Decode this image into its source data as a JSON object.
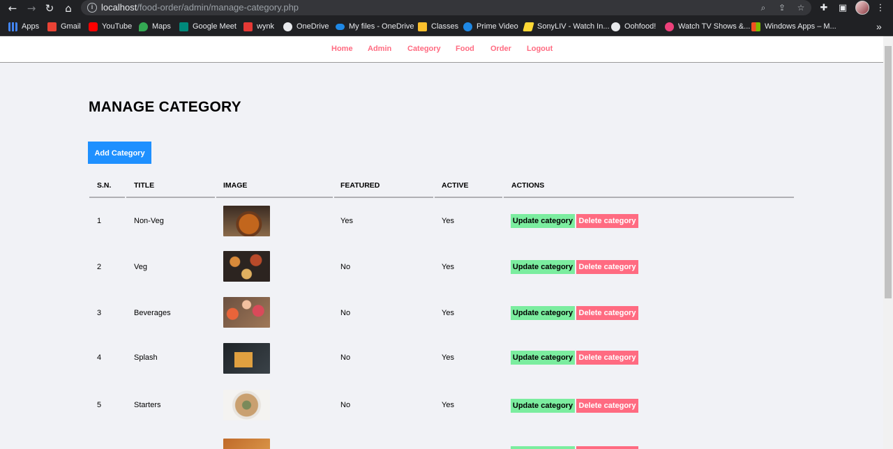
{
  "browser": {
    "url_host": "localhost",
    "url_path": "/food-order/admin/manage-category.php",
    "bookmarks": [
      {
        "label": "Apps",
        "color": "#4285f4"
      },
      {
        "label": "Gmail",
        "color": "#ea4335"
      },
      {
        "label": "YouTube",
        "color": "#ff0000"
      },
      {
        "label": "Maps",
        "color": "#34a853"
      },
      {
        "label": "Google Meet",
        "color": "#00897b"
      },
      {
        "label": "wynk",
        "color": "#e53935"
      },
      {
        "label": "OneDrive",
        "color": "#e8eaed"
      },
      {
        "label": "My files - OneDrive",
        "color": "#1e88e5"
      },
      {
        "label": "Classes",
        "color": "#fbc02d"
      },
      {
        "label": "Prime Video",
        "color": "#1e88e5"
      },
      {
        "label": "SonyLIV - Watch In...",
        "color": "#fdd835"
      },
      {
        "label": "Oohfood!",
        "color": "#e8eaed"
      },
      {
        "label": "Watch TV Shows &...",
        "color": "#ec407a"
      },
      {
        "label": "Windows Apps – M...",
        "color": "#f25022"
      }
    ]
  },
  "menu": {
    "home": "Home",
    "admin": "Admin",
    "category": "Category",
    "food": "Food",
    "order": "Order",
    "logout": "Logout"
  },
  "page": {
    "title": "MANAGE CATEGORY",
    "add_button": "Add Category"
  },
  "table": {
    "headers": [
      "S.N.",
      "TITLE",
      "IMAGE",
      "FEATURED",
      "ACTIVE",
      "ACTIONS"
    ],
    "update_label": "Update category",
    "delete_label": "Delete category",
    "rows": [
      {
        "sn": "1",
        "title": "Non-Veg",
        "featured": "Yes",
        "active": "Yes"
      },
      {
        "sn": "2",
        "title": "Veg",
        "featured": "No",
        "active": "Yes"
      },
      {
        "sn": "3",
        "title": "Beverages",
        "featured": "No",
        "active": "Yes"
      },
      {
        "sn": "4",
        "title": "Splash",
        "featured": "No",
        "active": "Yes"
      },
      {
        "sn": "5",
        "title": "Starters",
        "featured": "No",
        "active": "Yes"
      }
    ]
  },
  "colors": {
    "accent": "#ff6b81",
    "primary_button": "#1e90ff",
    "update_button": "#7bed9f",
    "delete_button": "#ff6b81"
  }
}
